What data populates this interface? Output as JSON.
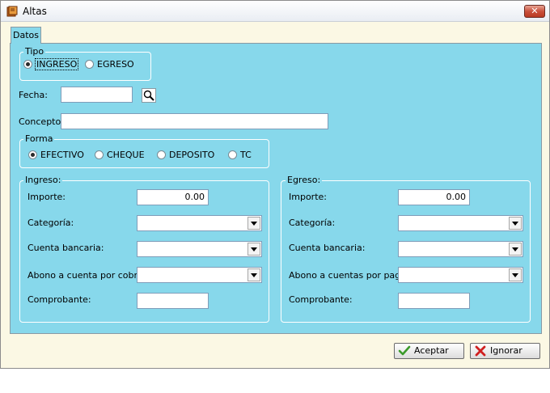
{
  "window": {
    "title": "Altas",
    "close_label": "✕"
  },
  "tabs": [
    {
      "label": "Datos"
    }
  ],
  "tipo": {
    "legend": "Tipo",
    "options": [
      {
        "label": "INGRESO",
        "checked": true
      },
      {
        "label": "EGRESO",
        "checked": false
      }
    ]
  },
  "fecha": {
    "label": "Fecha:",
    "value": ""
  },
  "concepto": {
    "label": "Concepto:",
    "value": ""
  },
  "forma": {
    "legend": "Forma",
    "options": [
      {
        "label": "EFECTIVO",
        "checked": true
      },
      {
        "label": "CHEQUE",
        "checked": false
      },
      {
        "label": "DEPOSITO",
        "checked": false
      },
      {
        "label": "TC",
        "checked": false
      }
    ]
  },
  "ingreso": {
    "legend": "Ingreso:",
    "importe_label": "Importe:",
    "importe_value": "0.00",
    "categoria_label": "Categoría:",
    "categoria_value": "",
    "cuenta_label": "Cuenta bancaria:",
    "cuenta_value": "",
    "abono_label": "Abono a cuenta por cobrar:",
    "abono_value": "",
    "comprobante_label": "Comprobante:",
    "comprobante_value": ""
  },
  "egreso": {
    "legend": "Egreso:",
    "importe_label": "Importe:",
    "importe_value": "0.00",
    "categoria_label": "Categoría:",
    "categoria_value": "",
    "cuenta_label": "Cuenta bancaria:",
    "cuenta_value": "",
    "abono_label": "Abono a cuentas por pagar:",
    "abono_value": "",
    "comprobante_label": "Comprobante:",
    "comprobante_value": ""
  },
  "buttons": {
    "accept_label": "Aceptar",
    "ignore_label": "Ignorar"
  },
  "icons": {
    "app": "book-icon",
    "search": "magnifier-icon",
    "accept": "check-icon",
    "ignore": "x-icon",
    "dropdown": "chevron-down-icon"
  },
  "colors": {
    "panel": "#87d8eb",
    "window": "#fbf8e4",
    "accept_icon": "#3a9a2a",
    "ignore_icon": "#d02020"
  }
}
